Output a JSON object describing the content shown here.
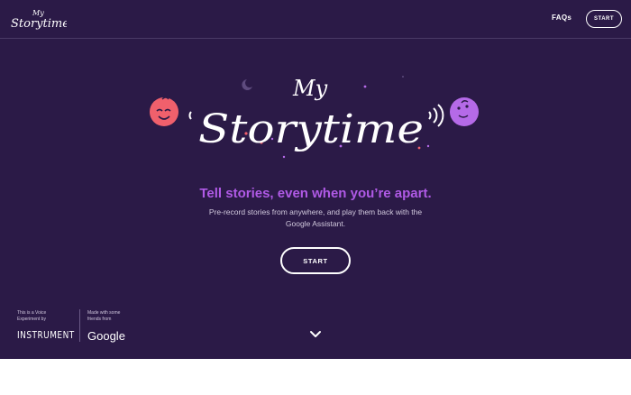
{
  "header": {
    "logo_small": {
      "line1": "My",
      "line2": "Storytime"
    },
    "faqs_label": "FAQs",
    "start_label": "START"
  },
  "hero": {
    "logo_my": "My",
    "logo_storytime": "Storytime",
    "tagline": "Tell stories, even when you’re apart.",
    "subtitle": "Pre-record stories from anywhere, and play them back with the Google Assistant.",
    "start_label": "START"
  },
  "footer": {
    "voice_label": "This is a Voice Experiment by",
    "instrument": "INSTRUMENT",
    "made_label": "Made with some friends from",
    "google": "Google"
  },
  "colors": {
    "background": "#2b1a47",
    "accent_purple": "#b05ae6",
    "coral": "#f0606c",
    "lavender": "#b56ae8"
  },
  "icons": {
    "scroll": "chevron-down-icon"
  }
}
